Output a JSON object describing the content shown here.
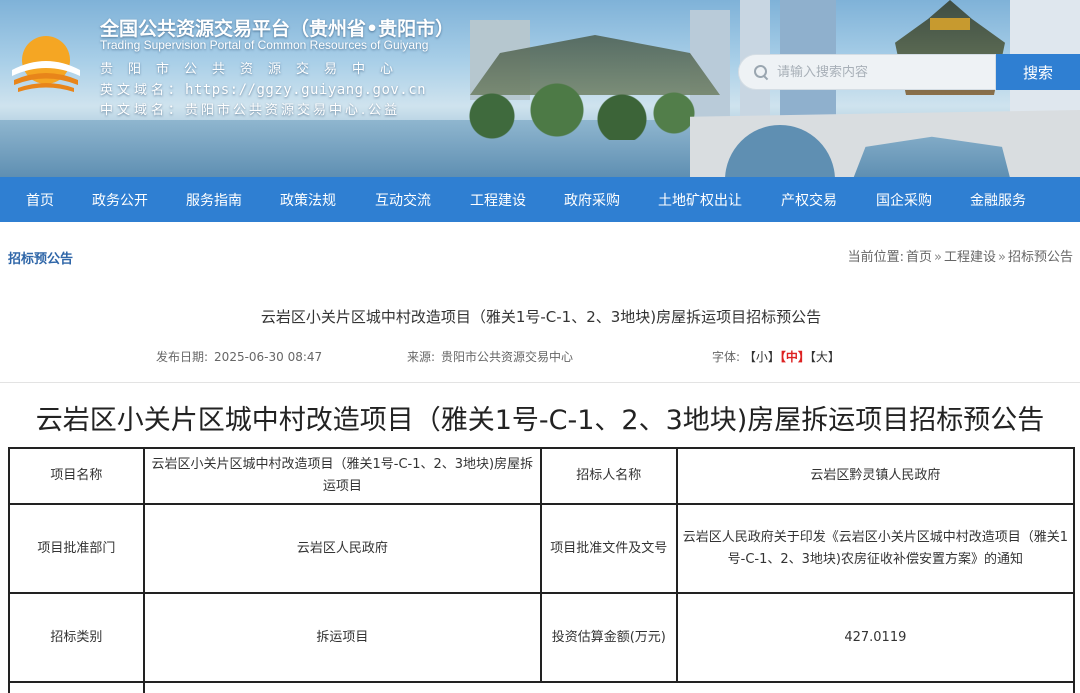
{
  "header": {
    "site_title": "全国公共资源交易平台（贵州省•贵阳市）",
    "site_subtitle": "Trading Supervision Portal of Common Resources of Guiyang",
    "org_name": "贵阳市公共资源交易中心",
    "en_domain_label": "英文域名：",
    "en_domain_value": "https://ggzy.guiyang.gov.cn",
    "cn_domain_label": "中文域名：",
    "cn_domain_value": "贵阳市公共资源交易中心.公益",
    "search_placeholder": "请输入搜索内容",
    "search_button": "搜索"
  },
  "nav": {
    "items": [
      "首页",
      "政务公开",
      "服务指南",
      "政策法规",
      "互动交流",
      "工程建设",
      "政府采购",
      "土地矿权出让",
      "产权交易",
      "国企采购",
      "金融服务"
    ]
  },
  "breadcrumb": {
    "section_title": "招标预公告",
    "prefix": "当前位置:",
    "items": [
      "首页",
      "工程建设",
      "招标预公告"
    ],
    "separator": "»"
  },
  "article": {
    "title": "云岩区小关片区城中村改造项目（雅关1号-C-1、2、3地块)房屋拆运项目招标预公告",
    "publish_label": "发布日期:",
    "publish_date": "2025-06-30 08:47",
    "source_label": "来源:",
    "source_value": "贵阳市公共资源交易中心",
    "font_label": "字体:",
    "font_sizes": [
      "【小】",
      "【中】",
      "【大】"
    ],
    "body_title": "云岩区小关片区城中村改造项目（雅关1号-C-1、2、3地块)房屋拆运项目招标预公告"
  },
  "table": {
    "rows": [
      [
        "项目名称",
        "云岩区小关片区城中村改造项目（雅关1号-C-1、2、3地块)房屋拆运项目",
        "招标人名称",
        "云岩区黔灵镇人民政府"
      ],
      [
        "项目批准部门",
        "云岩区人民政府",
        "项目批准文件及文号",
        "云岩区人民政府关于印发《云岩区小关片区城中村改造项目（雅关1号-C-1、2、3地块)农房征收补偿安置方案》的通知"
      ],
      [
        "招标类别",
        "拆运项目",
        "投资估算金额(万元)",
        "427.0119"
      ]
    ]
  },
  "colors": {
    "nav_bg": "#2f7fd2",
    "accent_red": "#d22222",
    "crumb_title": "#2f66a8"
  }
}
